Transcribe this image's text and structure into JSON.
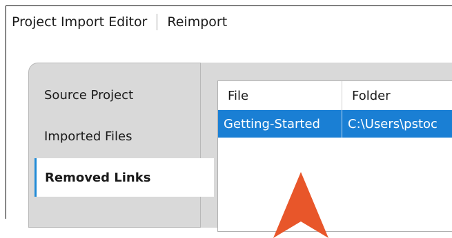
{
  "titlebar": {
    "title": "Project Import Editor",
    "action": "Reimport"
  },
  "tabs": [
    {
      "label": "Source Project"
    },
    {
      "label": "Imported Files"
    },
    {
      "label": "Removed Links"
    }
  ],
  "table": {
    "columns": [
      "File",
      "Folder"
    ],
    "rows": [
      {
        "file": "Getting-Started",
        "folder": "C:\\Users\\pstoc",
        "selected": true
      }
    ]
  },
  "colors": {
    "selection": "#1a7fd4",
    "tab_accent": "#1f8ad6",
    "arrow": "#e8562a"
  },
  "icons": {
    "pointer": "up-arrow-pointer-icon"
  }
}
